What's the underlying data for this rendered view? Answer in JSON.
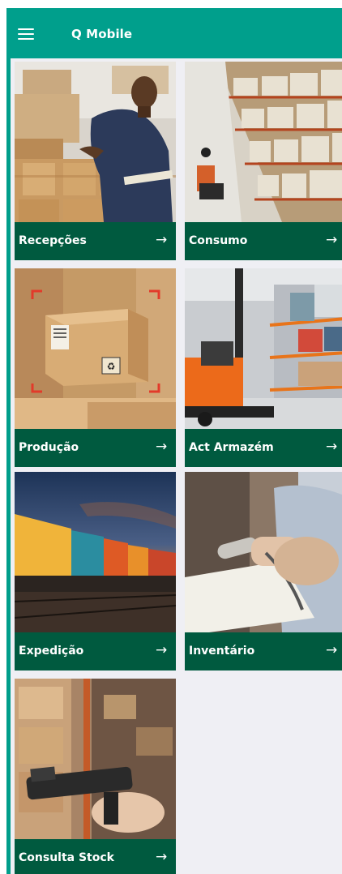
{
  "header": {
    "title": "Q Mobile",
    "menu_icon": "hamburger-menu-icon"
  },
  "tiles": [
    {
      "label": "Recepções",
      "arrow": "→",
      "image": "warehouse-worker-boxes-photo"
    },
    {
      "label": "Consumo",
      "arrow": "→",
      "image": "warehouse-shelves-forklift-photo"
    },
    {
      "label": "Produção",
      "arrow": "→",
      "image": "cardboard-box-scan-photo"
    },
    {
      "label": "Act Armazém",
      "arrow": "→",
      "image": "orange-forklift-racks-photo"
    },
    {
      "label": "Expedição",
      "arrow": "→",
      "image": "freight-train-containers-photo"
    },
    {
      "label": "Inventário",
      "arrow": "→",
      "image": "barcode-scanner-clipboard-photo"
    },
    {
      "label": "Consulta Stock",
      "arrow": "→",
      "image": "handheld-scanner-shelves-photo"
    }
  ],
  "colors": {
    "header": "#009f8c",
    "tile_bar": "#005a3f",
    "background": "#efeff4"
  }
}
